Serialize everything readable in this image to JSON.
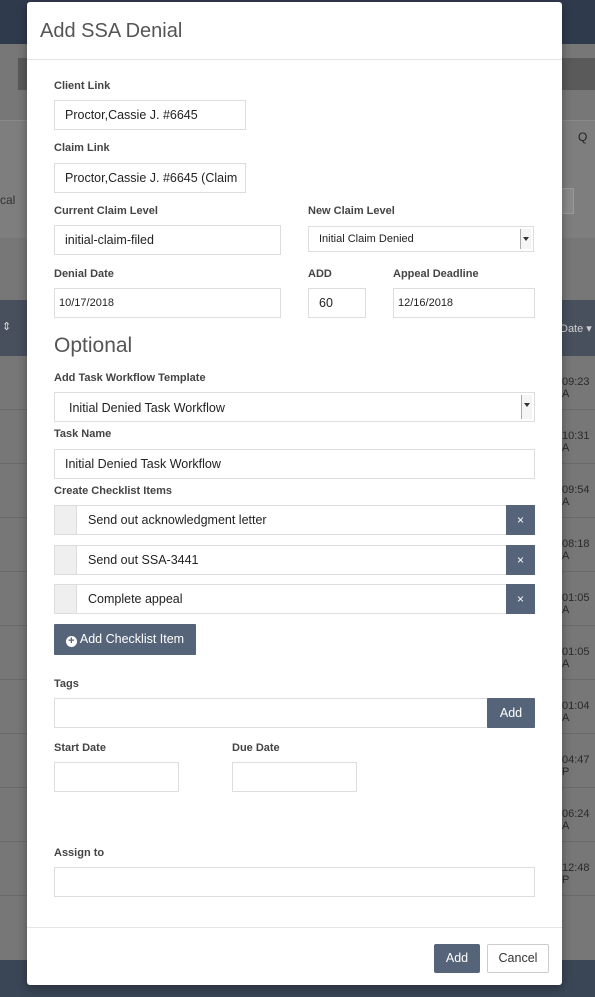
{
  "background": {
    "q_letter": "Q",
    "cal_text": "cal",
    "date_header": "Date",
    "times": [
      "09:23 A",
      "10:31 A",
      "09:54 A",
      "08:18 A",
      "01:05 A",
      "01:05 A",
      "01:04 A",
      "04:47 P",
      "06:24 A",
      "12:48 P"
    ]
  },
  "modal": {
    "title": "Add SSA Denial",
    "client_link": {
      "label": "Client Link",
      "value": "Proctor,Cassie J. #6645"
    },
    "claim_link": {
      "label": "Claim Link",
      "value": "Proctor,Cassie J. #6645 (Claim"
    },
    "current_claim_level": {
      "label": "Current Claim Level",
      "value": "initial-claim-filed"
    },
    "new_claim_level": {
      "label": "New Claim Level",
      "selected": "Initial Claim Denied"
    },
    "denial_date": {
      "label": "Denial Date",
      "value": "10/17/2018"
    },
    "add": {
      "label": "ADD",
      "value": "60"
    },
    "appeal_deadline": {
      "label": "Appeal Deadline",
      "value": "12/16/2018"
    },
    "optional_title": "Optional",
    "task_workflow_template": {
      "label": "Add Task Workflow Template",
      "selected": "Initial Denied Task Workflow"
    },
    "task_name": {
      "label": "Task Name",
      "value": "Initial Denied Task Workflow"
    },
    "checklist": {
      "label": "Create Checklist Items",
      "items": [
        "Send out acknowledgment letter",
        "Send out SSA-3441",
        "Complete appeal"
      ],
      "remove_symbol": "×",
      "add_button": "Add Checklist Item"
    },
    "tags": {
      "label": "Tags",
      "value": "",
      "add_button": "Add"
    },
    "start_date": {
      "label": "Start Date",
      "value": ""
    },
    "due_date": {
      "label": "Due Date",
      "value": ""
    },
    "assign_to": {
      "label": "Assign to",
      "value": ""
    },
    "footer": {
      "add_button": "Add",
      "cancel_button": "Cancel"
    }
  }
}
